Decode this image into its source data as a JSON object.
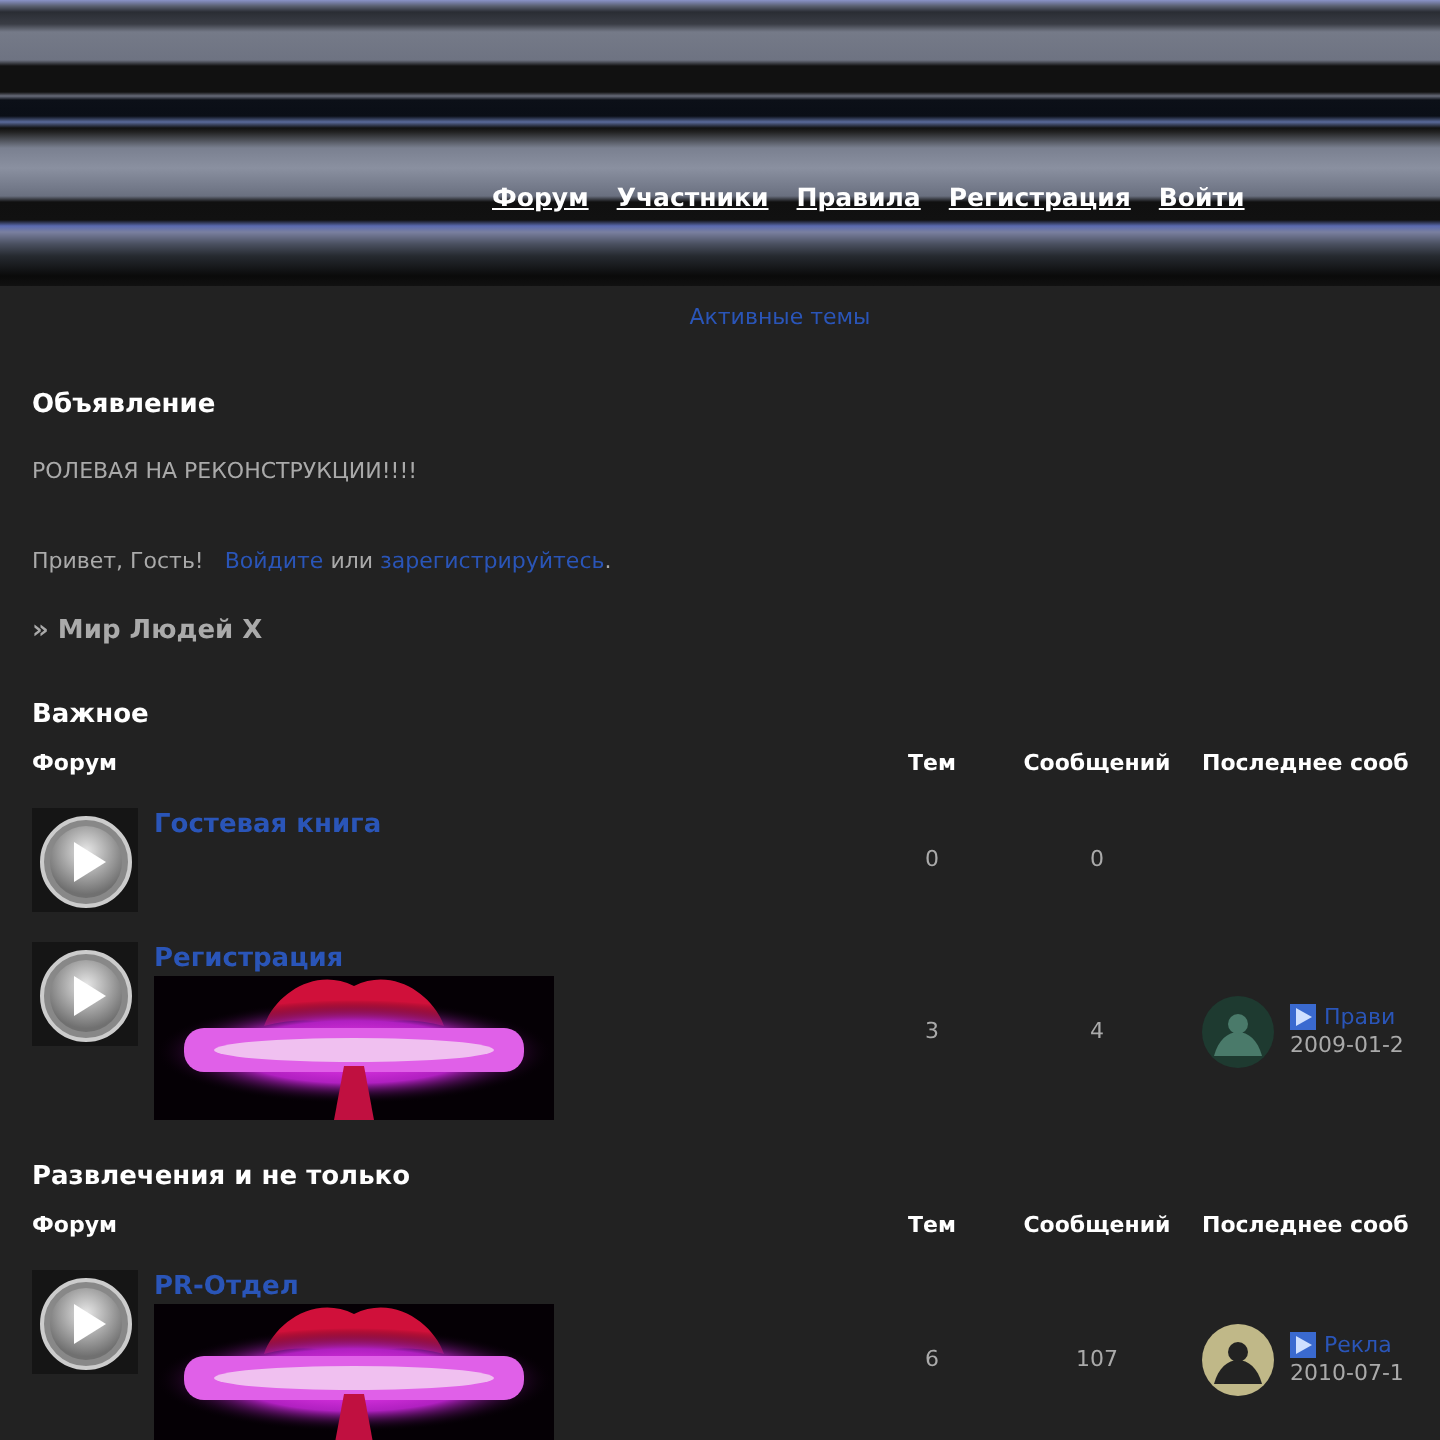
{
  "nav": [
    "Форум",
    "Участники",
    "Правила",
    "Регистрация",
    "Войти"
  ],
  "top_link": "Активные темы",
  "announcement": {
    "title": "Объявление",
    "text": "РОЛЕВАЯ НА РЕКОНСТРУКЦИИ!!!!"
  },
  "welcome": {
    "greeting": "Привет, Гость!",
    "login_link": "Войдите",
    "joiner": "или",
    "register_link": "зарегистрируйтесь",
    "end": "."
  },
  "breadcrumb": "» Мир Людей X",
  "categories": [
    {
      "title": "Важное",
      "columns": [
        "Форум",
        "Тем",
        "Сообщений",
        "Последнее сооб"
      ],
      "forums": [
        {
          "title": "Гостевая книга",
          "topics": "0",
          "posts": "0"
        },
        {
          "title": "Регистрация",
          "topics": "3",
          "posts": "4",
          "last_post": {
            "title": "Прави",
            "date": "2009-01-2"
          }
        }
      ]
    },
    {
      "title": "Развлечения и не только",
      "columns": [
        "Форум",
        "Тем",
        "Сообщений",
        "Последнее сооб"
      ],
      "forums": [
        {
          "title": "PR-Отдел",
          "topics": "6",
          "posts": "107",
          "last_post": {
            "title": "Рекла",
            "date": "2010-07-1"
          }
        }
      ]
    }
  ]
}
